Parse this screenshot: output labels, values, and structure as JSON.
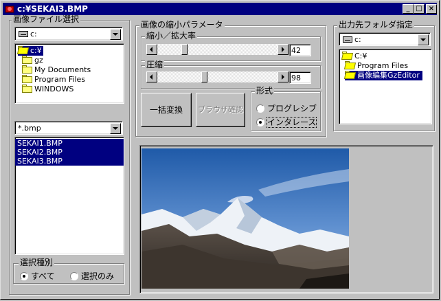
{
  "window": {
    "title": "c:¥SEKAI3.BMP",
    "controls": {
      "minimize": "_",
      "maximize": "□",
      "close": "×"
    }
  },
  "file_select": {
    "group_label": "画像ファイル選択",
    "drive": "c:",
    "folders": [
      "c:¥",
      "gz",
      "My Documents",
      "Program Files",
      "WINDOWS"
    ],
    "filter": "*.bmp",
    "files": [
      "SEKAI1.BMP",
      "SEKAI2.BMP",
      "SEKAI3.BMP"
    ],
    "selection_type": {
      "label": "選択種別",
      "options": [
        {
          "label": "すべて",
          "checked": true
        },
        {
          "label": "選択のみ",
          "checked": false
        }
      ]
    }
  },
  "params": {
    "group_label": "画像の縮小パラメータ",
    "scale": {
      "label": "縮小／拡大率",
      "value": "42"
    },
    "compression": {
      "label": "圧縮",
      "value": "98"
    },
    "batch_button": "一括変換",
    "browser_button": "ブラウザ確認",
    "format": {
      "label": "形式",
      "options": [
        {
          "label": "プログレシブ",
          "checked": false
        },
        {
          "label": "インタレース",
          "checked": true
        }
      ]
    }
  },
  "output": {
    "group_label": "出力先フォルダ指定",
    "drive": "c:",
    "folders": [
      "C:¥",
      "Program Files",
      "画像編集GzEditor"
    ]
  },
  "preview": {
    "image_name": "mountain-landscape-preview"
  },
  "colors": {
    "face": "#c0c0c0",
    "title_bar": "#000080",
    "selection": "#000080",
    "preview_bg": "#c0c0c0"
  }
}
